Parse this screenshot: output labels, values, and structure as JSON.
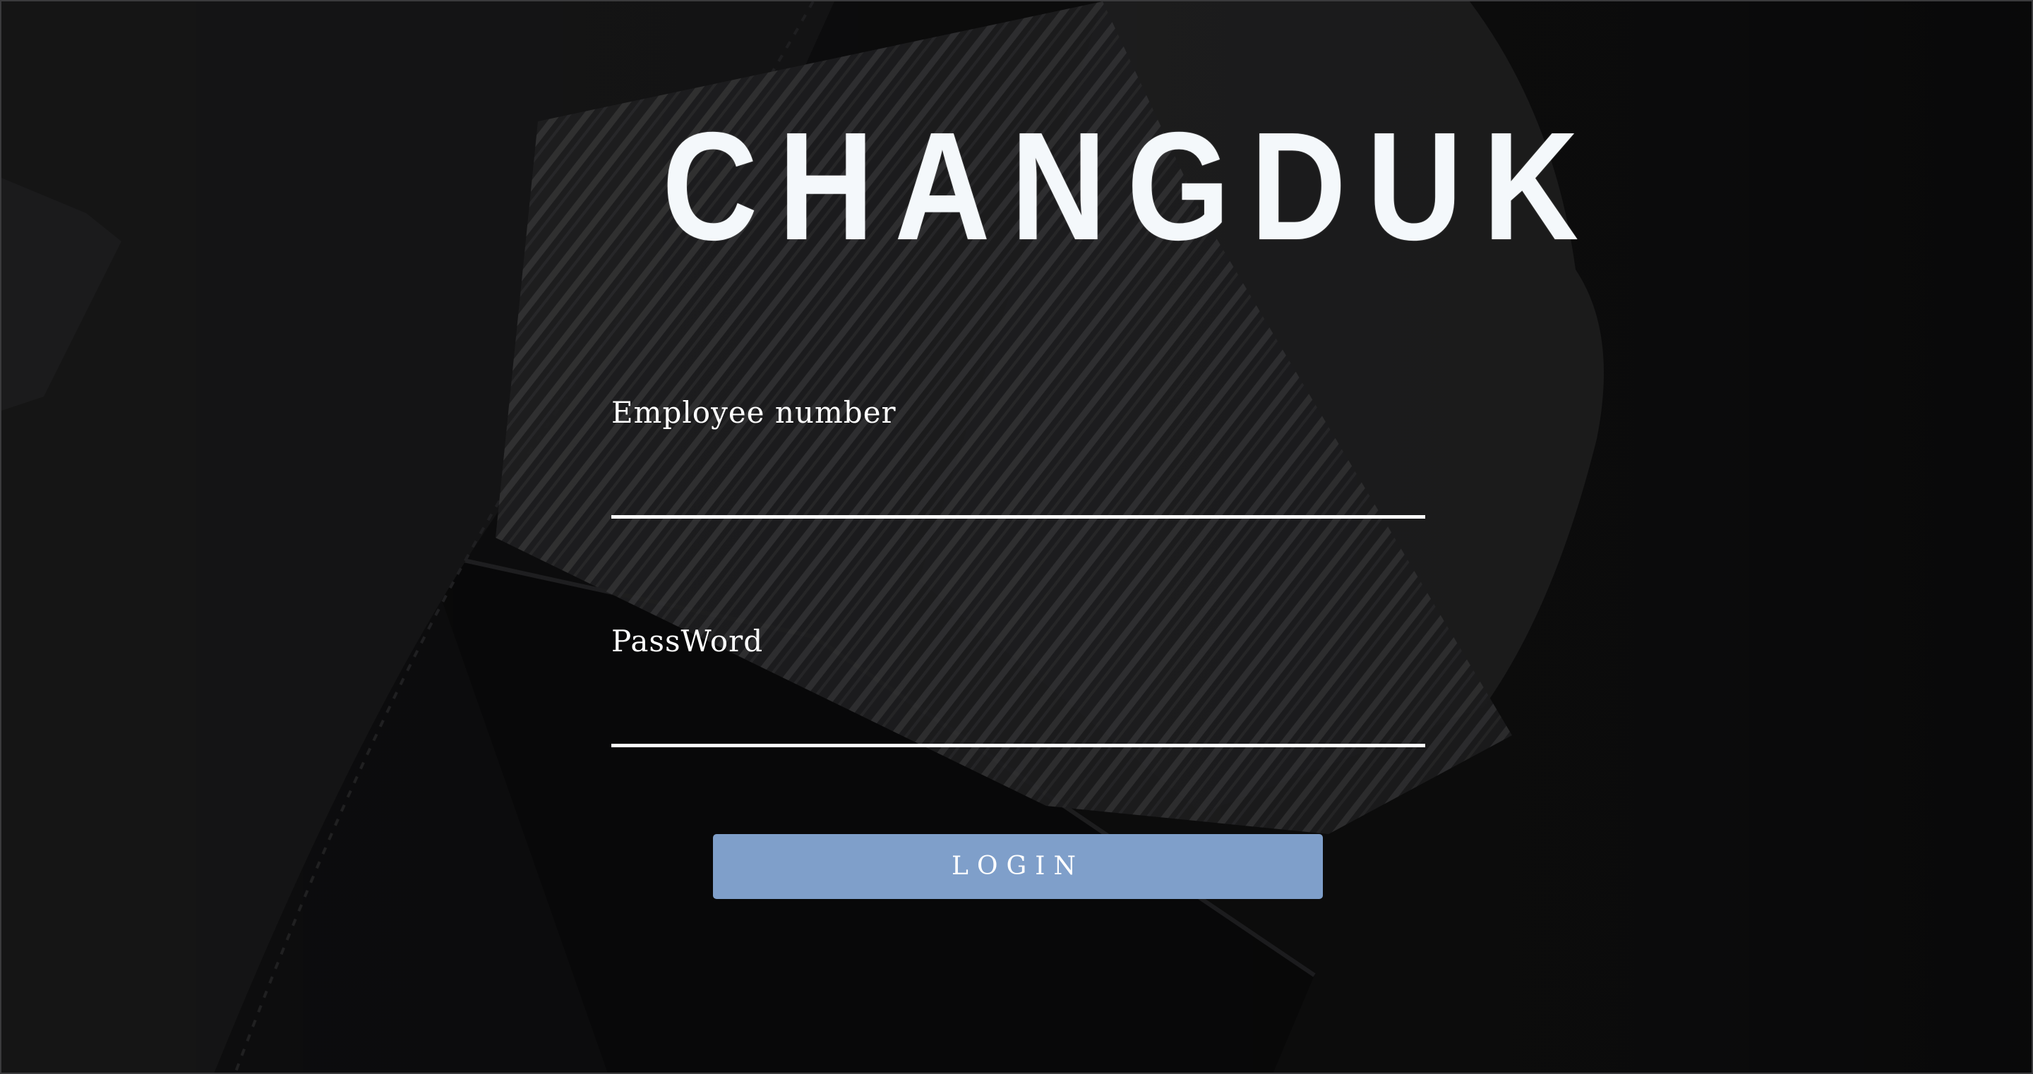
{
  "brand": {
    "logo_text": "CHANGDUK"
  },
  "form": {
    "employee_label": "Employee number",
    "employee_value": "",
    "password_label": "PassWord",
    "password_value": "",
    "login_label": "LOGIN"
  },
  "colors": {
    "background": "#141415",
    "logo": "#f4f8fb",
    "underline": "#ffffff",
    "login_button": "#7f9fca"
  }
}
